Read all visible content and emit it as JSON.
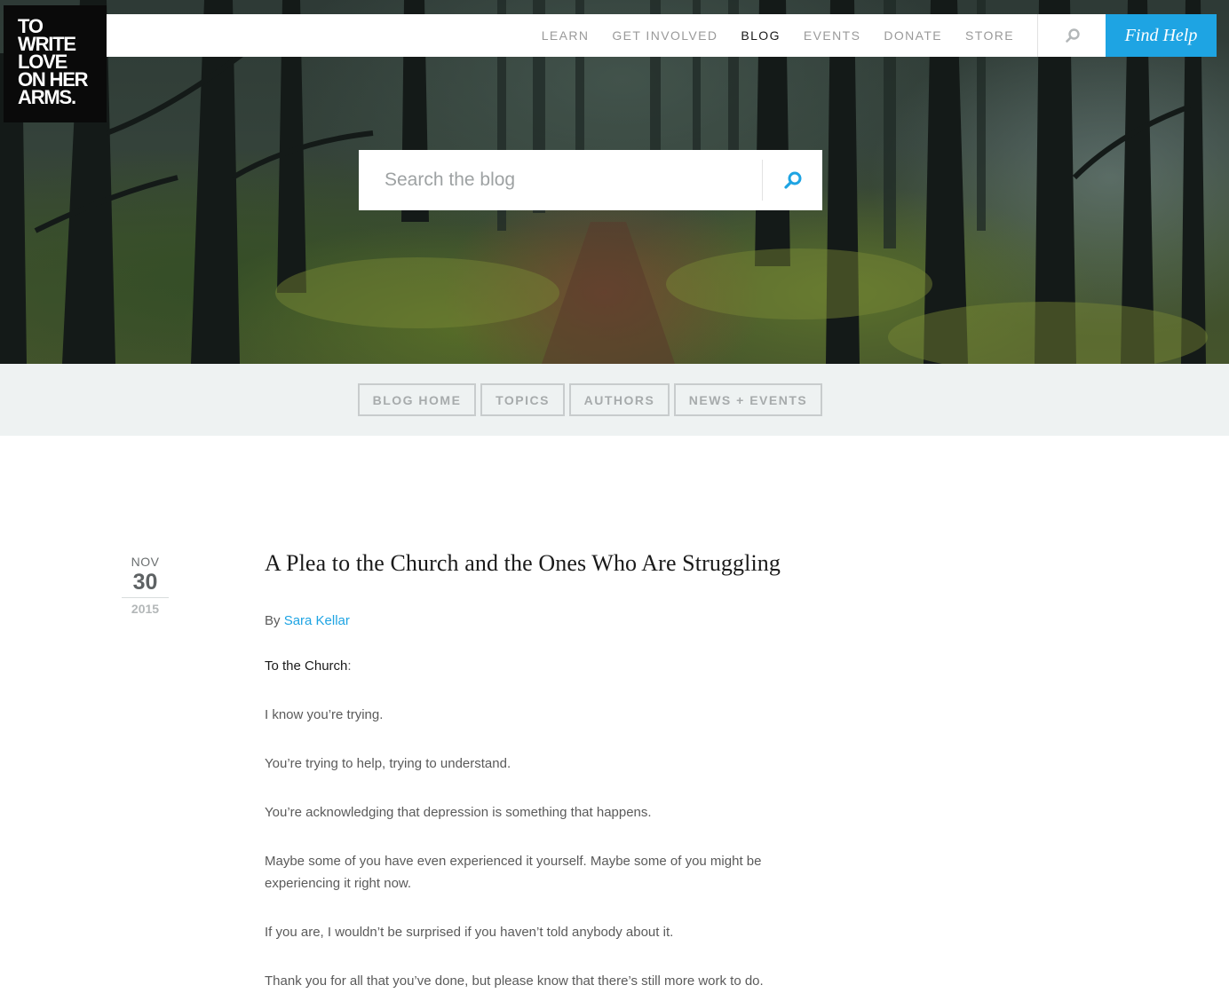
{
  "logo": {
    "lines": [
      "TO",
      "WRITE",
      "LOVE",
      "ON HER",
      "ARMS."
    ]
  },
  "nav": {
    "items": [
      {
        "label": "LEARN",
        "active": false
      },
      {
        "label": "GET INVOLVED",
        "active": false
      },
      {
        "label": "BLOG",
        "active": true
      },
      {
        "label": "EVENTS",
        "active": false
      },
      {
        "label": "DONATE",
        "active": false
      },
      {
        "label": "STORE",
        "active": false
      }
    ],
    "search_icon": "search-icon",
    "cta_label": "Find Help"
  },
  "blog_search": {
    "placeholder": "Search the blog",
    "icon": "search-icon"
  },
  "subnav": {
    "items": [
      "BLOG HOME",
      "TOPICS",
      "AUTHORS",
      "NEWS + EVENTS"
    ]
  },
  "post": {
    "date": {
      "month": "NOV",
      "day": "30",
      "year": "2015"
    },
    "title": "A Plea to the Church and the Ones Who Are Struggling",
    "byline_prefix": "By",
    "author": "Sara Kellar",
    "salutation": "To the Church",
    "salutation_suffix": ":",
    "paragraphs": [
      "I know you’re trying.",
      "You’re trying to help, trying to understand.",
      "You’re acknowledging that depression is something that happens.",
      "Maybe some of you have even experienced it yourself. Maybe some of you might be experiencing it right now.",
      "If you are, I wouldn’t be surprised if you haven’t told anybody about it.",
      "Thank you for all that you’ve done, but please know that there’s still more work to do."
    ]
  },
  "colors": {
    "accent": "#1ea4e3",
    "logo_bg": "#0a0a0a",
    "subnav_bg": "#eef2f2"
  }
}
